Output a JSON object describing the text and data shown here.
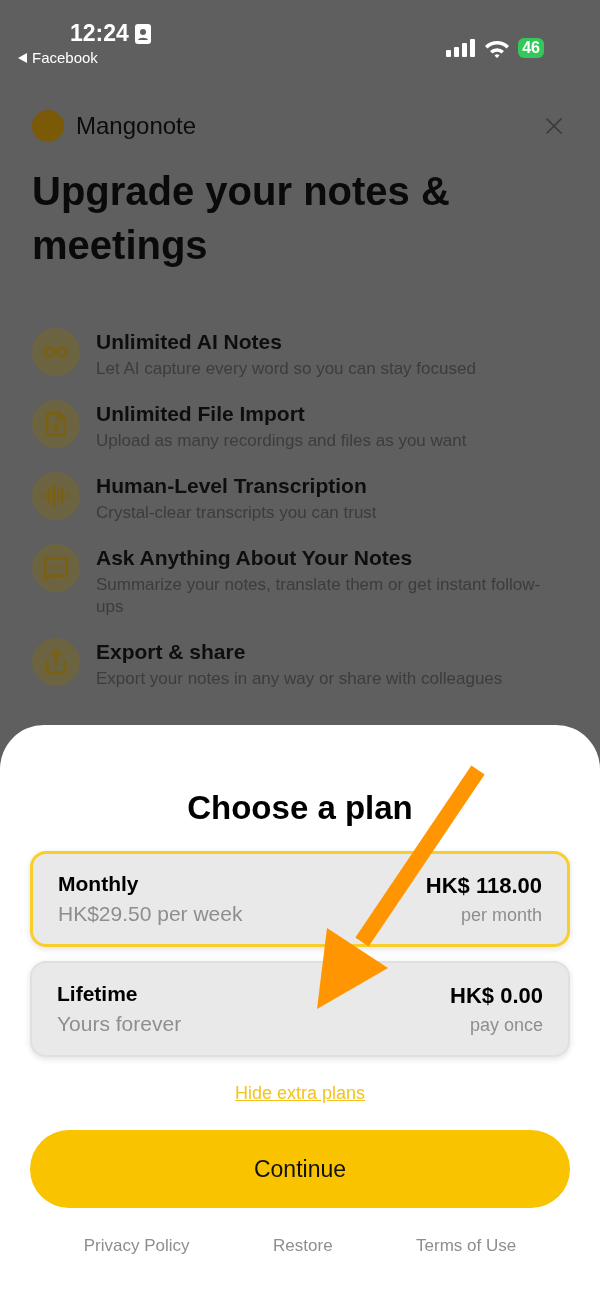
{
  "status_bar": {
    "time": "12:24",
    "back_label": "Facebook",
    "battery": "46"
  },
  "brand": {
    "name": "Mangonote"
  },
  "headline": "Upgrade your notes & meetings",
  "features": [
    {
      "kind": "infinity",
      "title": "Unlimited AI Notes",
      "description": "Let AI capture every word so you can stay focused"
    },
    {
      "kind": "file",
      "title": "Unlimited File Import",
      "description": "Upload as many recordings and files as you want"
    },
    {
      "kind": "audio",
      "title": "Human-Level Transcription",
      "description": "Crystal-clear transcripts you can trust"
    },
    {
      "kind": "chat",
      "title": "Ask Anything About Your Notes",
      "description": "Summarize your notes, translate them or get instant follow-ups"
    },
    {
      "kind": "share",
      "title": "Export & share",
      "description": "Export your notes in any way or share with colleagues"
    }
  ],
  "sheet": {
    "title": "Choose a plan",
    "plans": [
      {
        "name": "Monthly",
        "subtitle": "HK$29.50 per week",
        "price": "HK$ 118.00",
        "period": "per month",
        "selected": true
      },
      {
        "name": "Lifetime",
        "subtitle": "Yours forever",
        "price": "HK$ 0.00",
        "period": "pay once",
        "selected": false
      }
    ],
    "toggle_link": "Hide extra plans",
    "continue_button": "Continue",
    "footer_links": [
      "Privacy Policy",
      "Restore",
      "Terms of Use"
    ]
  }
}
